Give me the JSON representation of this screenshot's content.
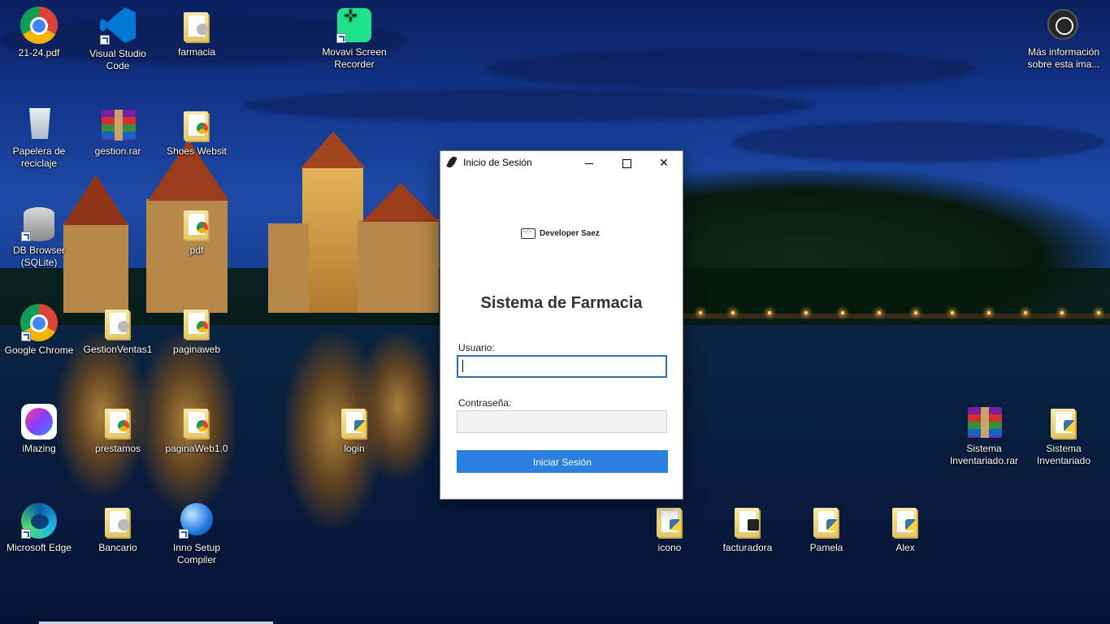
{
  "desktop": {
    "icons": [
      {
        "label": "21-24.pdf",
        "icon": "chrome-pdf-icon"
      },
      {
        "label": "Visual Studio\nCode",
        "icon": "vscode-icon"
      },
      {
        "label": "farmacia",
        "icon": "folder-icon"
      },
      {
        "label": "Movavi Screen\nRecorder",
        "icon": "movavi-icon"
      },
      {
        "label": "Más información\nsobre esta ima...",
        "icon": "info-icon"
      },
      {
        "label": "Papelera de\nreciclaje",
        "icon": "recycle-bin-icon"
      },
      {
        "label": "gestion.rar",
        "icon": "winrar-icon"
      },
      {
        "label": "Shoes Websit",
        "icon": "folder-chrome-icon"
      },
      {
        "label": "DB Browser\n(SQLite)",
        "icon": "database-icon"
      },
      {
        "label": "pdf",
        "icon": "folder-chrome-icon"
      },
      {
        "label": "Google Chrome",
        "icon": "chrome-icon"
      },
      {
        "label": "GestionVentas1",
        "icon": "folder-icon"
      },
      {
        "label": "paginaweb",
        "icon": "folder-chrome-icon"
      },
      {
        "label": "iMazing",
        "icon": "imazing-icon"
      },
      {
        "label": "prestamos",
        "icon": "folder-chrome-icon"
      },
      {
        "label": "paginaWeb1.0",
        "icon": "folder-chrome-icon"
      },
      {
        "label": "login",
        "icon": "folder-python-icon"
      },
      {
        "label": "Sistema\nInventariado.rar",
        "icon": "winrar-icon"
      },
      {
        "label": "Sistema\nInventariado",
        "icon": "folder-python-icon"
      },
      {
        "label": "Microsoft Edge",
        "icon": "edge-icon"
      },
      {
        "label": "Bancario",
        "icon": "folder-icon"
      },
      {
        "label": "Inno Setup\nCompiler",
        "icon": "inno-setup-icon"
      },
      {
        "label": "icono",
        "icon": "folder-icon"
      },
      {
        "label": "facturadora",
        "icon": "folder-icon"
      },
      {
        "label": "Pamela",
        "icon": "folder-python-icon"
      },
      {
        "label": "Alex",
        "icon": "folder-python-icon"
      }
    ]
  },
  "window": {
    "title": "Inicio de Sesión",
    "logo_text": "Developer Saez",
    "heading": "Sistema de Farmacia",
    "username_label": "Usuario:",
    "username_value": "",
    "password_label": "Contraseña:",
    "password_value": "",
    "login_button": "Iniciar Sesión",
    "accent_color": "#2a7fe0"
  }
}
